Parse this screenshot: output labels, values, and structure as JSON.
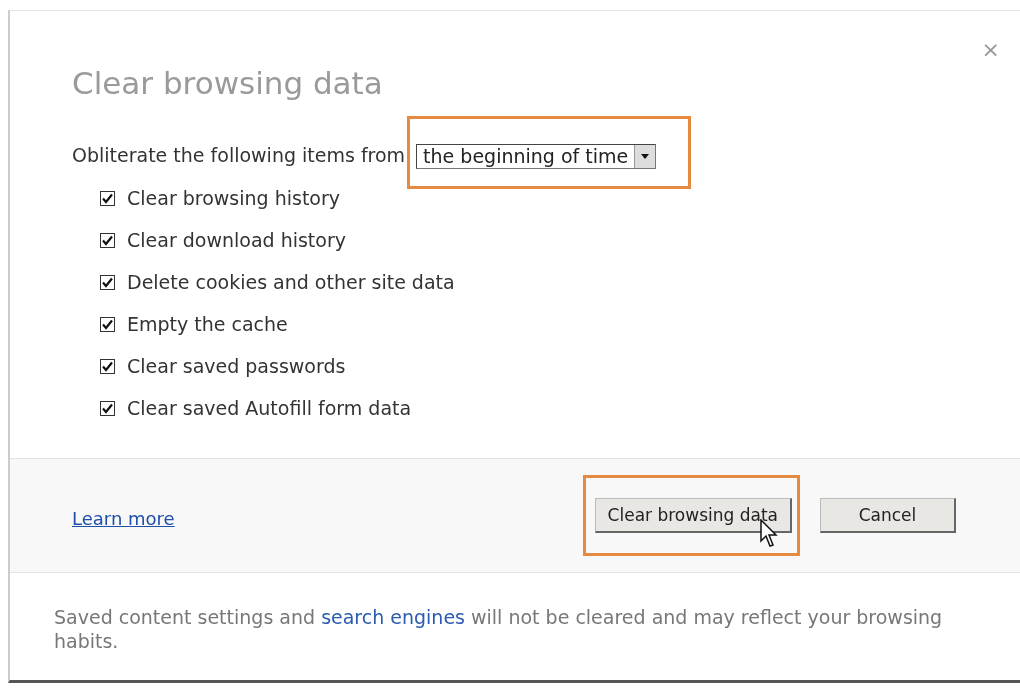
{
  "dialog": {
    "title": "Clear browsing data",
    "close": "×"
  },
  "time_range": {
    "label": "Obliterate the following items from",
    "value": "the beginning of time",
    "highlighted": true
  },
  "items": [
    {
      "label": "Clear browsing history",
      "checked": true
    },
    {
      "label": "Clear download history",
      "checked": true
    },
    {
      "label": "Delete cookies and other site data",
      "checked": true
    },
    {
      "label": "Empty the cache",
      "checked": true
    },
    {
      "label": "Clear saved passwords",
      "checked": true
    },
    {
      "label": "Clear saved Autofill form data",
      "checked": true
    }
  ],
  "footer": {
    "link": "Learn more",
    "buttons": [
      {
        "label": "Clear browsing data",
        "kind": "primary",
        "highlighted": true
      },
      {
        "label": "Cancel",
        "kind": "cancel",
        "highlighted": false
      }
    ]
  },
  "note": {
    "before": "Saved content settings and ",
    "link": "search engines",
    "after": " will not be cleared and may reflect your browsing habits."
  }
}
